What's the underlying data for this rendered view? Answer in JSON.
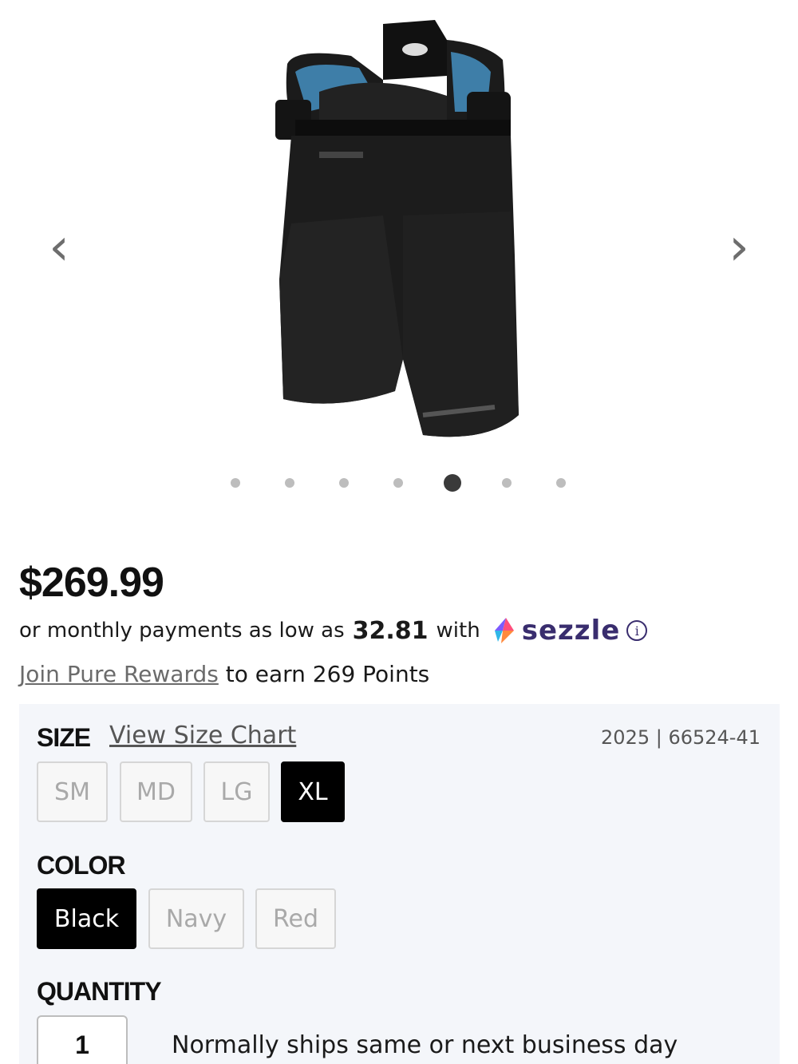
{
  "gallery": {
    "prev_icon": "chevron-left-icon",
    "next_icon": "chevron-right-icon",
    "product_image": "black CCM hockey pants product photo",
    "dot_count": 7,
    "active_dot_index": 4
  },
  "price": "$269.99",
  "financing": {
    "prefix": "or monthly payments as low as",
    "amount": "32.81",
    "with": "with",
    "provider": "sezzle",
    "info_icon": "info-icon"
  },
  "rewards": {
    "link": "Join Pure Rewards",
    "text": "to earn 269 Points"
  },
  "options": {
    "size_label": "SIZE",
    "size_chart_link": "View Size Chart",
    "sku": "2025 | 66524-41",
    "sizes": [
      "SM",
      "MD",
      "LG",
      "XL"
    ],
    "selected_size": "XL",
    "color_label": "COLOR",
    "colors": [
      "Black",
      "Navy",
      "Red"
    ],
    "selected_color": "Black",
    "quantity_label": "QUANTITY",
    "quantity": "1",
    "shipping": "Normally ships same or next business day"
  },
  "colors": {
    "sezzle_brand": "#392d6e",
    "selected_option": "#000000",
    "panel_background": "#f4f6fa"
  }
}
